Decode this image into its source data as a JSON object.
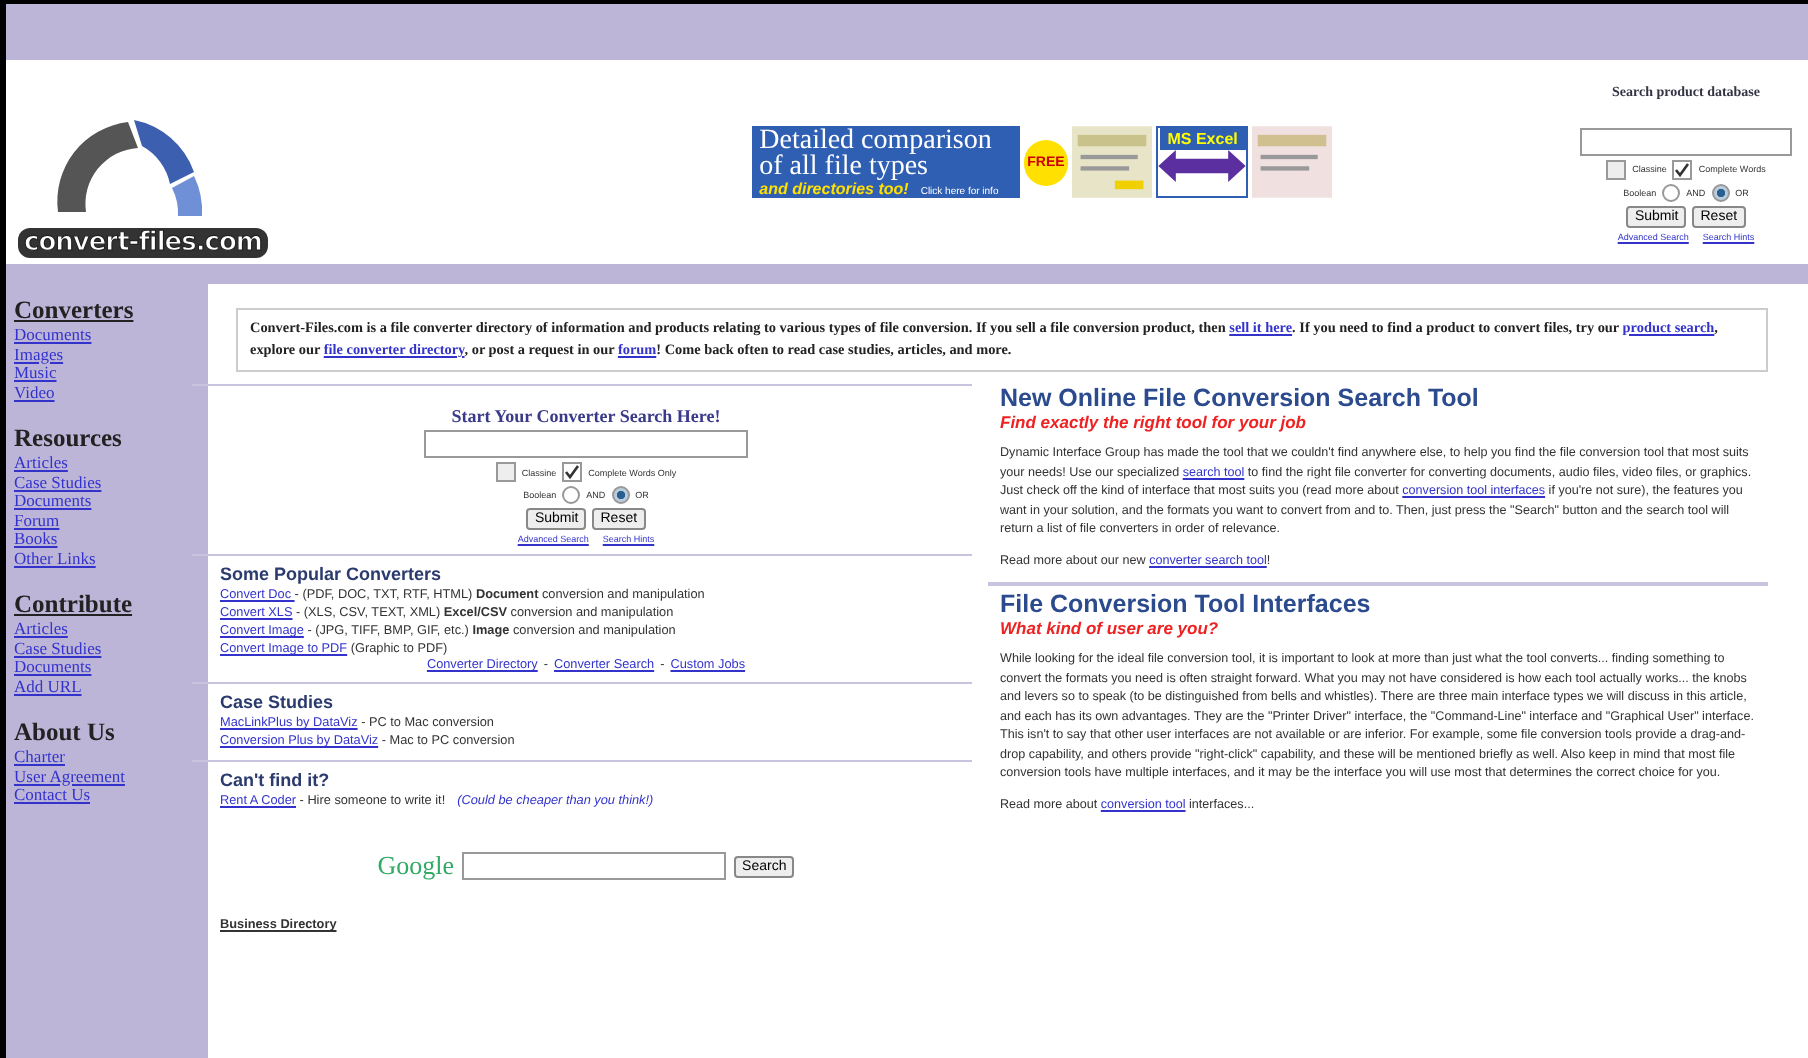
{
  "header": {
    "logo_text": "convert-files.com",
    "banner": {
      "headline": "Detailed comparison of all file types",
      "tagline": "and directories too!",
      "badge": "FREE",
      "product": "MS Excel",
      "cta": "Click here for info"
    },
    "product_search": {
      "title": "Search product database",
      "options": [
        {
          "label": "Classine",
          "checked": false
        },
        {
          "label": "Complete Words",
          "checked": true
        }
      ],
      "boolean_label": "Boolean",
      "radios": [
        {
          "label": "AND",
          "selected": false
        },
        {
          "label": "OR",
          "selected": true
        }
      ],
      "buttons": [
        "Submit",
        "Reset"
      ],
      "links": [
        "Advanced Search",
        "Search Hints"
      ]
    }
  },
  "sidebar": [
    {
      "heading": "Converters",
      "items": [
        "Documents",
        "Images",
        "Music",
        "Video"
      ]
    },
    {
      "heading": "Resources",
      "items": [
        "Articles",
        "Case Studies",
        "Documents",
        "Forum",
        "Books",
        "Other Links"
      ]
    },
    {
      "heading": "Contribute",
      "items": [
        "Articles",
        "Case Studies",
        "Documents",
        "Add URL"
      ]
    },
    {
      "heading": "About Us",
      "items": [
        "Charter",
        "User Agreement",
        "Contact Us"
      ]
    }
  ],
  "intro": [
    {
      "kind": "text",
      "text": "Convert-Files.com is a file converter directory of information and products relating to various types of file conversion.  If you sell a file conversion product, then "
    },
    {
      "kind": "link",
      "text": "sell it here"
    },
    {
      "kind": "text",
      "text": ". If you need to find a product to convert files, try our "
    },
    {
      "kind": "link",
      "text": "product search"
    },
    {
      "kind": "text",
      "text": ", explore our "
    },
    {
      "kind": "link",
      "text": "file converter directory"
    },
    {
      "kind": "text",
      "text": ", or post a request in our "
    },
    {
      "kind": "link",
      "text": "forum"
    },
    {
      "kind": "text",
      "text": "!  Come back often to read case studies, articles, and more."
    }
  ],
  "converter_search": {
    "title": "Start Your Converter Search Here!",
    "options": [
      {
        "label": "Classine",
        "checked": false
      },
      {
        "label": "Complete Words Only",
        "checked": true
      }
    ],
    "boolean_label": "Boolean",
    "radios": [
      {
        "label": "AND",
        "selected": false
      },
      {
        "label": "OR",
        "selected": true
      }
    ],
    "buttons": [
      "Submit",
      "Reset"
    ],
    "links": [
      "Advanced Search",
      "Search Hints"
    ]
  },
  "popular": {
    "title": "Some Popular Converters",
    "items": [
      {
        "link": "Convert Doc ",
        "text": " - (PDF, DOC, TXT, RTF, HTML) **Document** conversion and manipulation"
      },
      {
        "link": "Convert XLS",
        "text": " - (XLS, CSV, TEXT, XML) **Excel/CSV** conversion and manipulation"
      },
      {
        "link": "Convert Image",
        "text": " - (JPG, TIFF, BMP, GIF, etc.) **Image** conversion and manipulation"
      },
      {
        "link": "Convert Image to PDF",
        "text": " (Graphic to PDF)"
      }
    ],
    "footer_links": [
      "Converter Directory",
      "Converter Search",
      "Custom Jobs"
    ],
    "separator": "-"
  },
  "case_studies": {
    "title": "Case Studies",
    "items": [
      {
        "link": "MacLinkPlus by DataViz",
        "text": " - PC to Mac conversion"
      },
      {
        "link": "Conversion Plus by DataViz",
        "text": " - Mac to PC conversion"
      }
    ]
  },
  "cant_find": {
    "title": "Can't find it?",
    "link": "Rent A Coder",
    "text": " - Hire someone to write it!",
    "note": "(Could be cheaper than you think!)"
  },
  "google": {
    "logo": "Google",
    "button": "Search"
  },
  "business_directory": "Business Directory",
  "articles": [
    {
      "title": "New Online File Conversion Search Tool",
      "subtitle": "Find exactly the right tool for your job",
      "body": [
        {
          "kind": "text",
          "text": "Dynamic Interface Group has made the tool that we couldn't find anywhere else, to help you find the file conversion tool that most suits your needs!  Use our specialized "
        },
        {
          "kind": "link",
          "text": "search tool"
        },
        {
          "kind": "text",
          "text": " to find the right file converter for converting documents, audio files, video files, or graphics.  Just check off the kind of interface that most suits you (read more about "
        },
        {
          "kind": "link",
          "text": "conversion tool interfaces"
        },
        {
          "kind": "text",
          "text": " if you're not sure), the features you want in your solution, and the formats you want to convert from and to.  Then, just press the \"Search\" button and the search tool will return a list of file converters in order of relevance."
        }
      ],
      "more": [
        {
          "kind": "text",
          "text": "Read more about our new "
        },
        {
          "kind": "link",
          "text": "converter search tool"
        },
        {
          "kind": "text",
          "text": "!"
        }
      ]
    },
    {
      "title": "File Conversion Tool Interfaces",
      "subtitle": "What kind of user are you?",
      "body": [
        {
          "kind": "text",
          "text": "While looking for the ideal file conversion tool, it is important to look at more than just what the tool converts... finding something to convert the formats you need is often straight forward.  What you may not have considered is how each tool actually works... the knobs and levers so to speak (to be distinguished from bells and whistles).  There are three main interface types we will discuss in this article, and each has its own advantages.  They are the \"Printer Driver\" interface, the \"Command-Line\" interface and \"Graphical User\" interface.  This isn't to say that other user interfaces are not available or are inferior.  For example, some file conversion tools provide a drag-and-drop capability, and others provide \"right-click\" capability, and these will be mentioned briefly as well.  Also keep in mind that most file conversion tools have multiple interfaces, and it may be the interface you will use most that determines the correct choice for you."
        }
      ],
      "more": [
        {
          "kind": "text",
          "text": "Read more about "
        },
        {
          "kind": "link",
          "text": "conversion tool"
        },
        {
          "kind": "text",
          "text": " interfaces..."
        }
      ]
    }
  ]
}
